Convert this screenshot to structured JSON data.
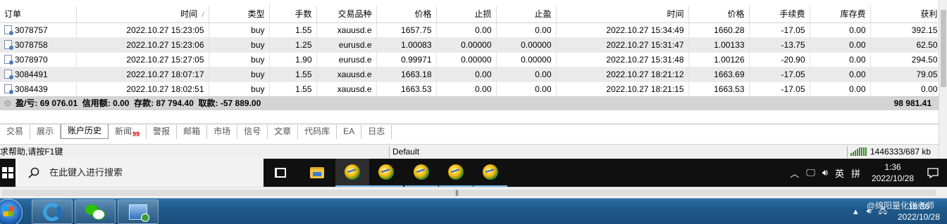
{
  "terminal": {
    "columns": [
      "订单",
      "时间",
      "类型",
      "手数",
      "交易品种",
      "价格",
      "止损",
      "止盈",
      "时间",
      "价格",
      "手续费",
      "库存费",
      "获利"
    ],
    "sort_indicator": "/",
    "orders": [
      {
        "ticket": "3078757",
        "open_time": "2022.10.27 15:23:05",
        "type": "buy",
        "lots": "1.55",
        "symbol": "xauusd.e",
        "open_price": "1657.75",
        "sl": "0.00",
        "tp": "0.00",
        "close_time": "2022.10.27 15:34:49",
        "close_price": "1660.28",
        "commission": "-17.05",
        "swap": "0.00",
        "profit": "392.15"
      },
      {
        "ticket": "3078758",
        "open_time": "2022.10.27 15:23:06",
        "type": "buy",
        "lots": "1.25",
        "symbol": "eurusd.e",
        "open_price": "1.00083",
        "sl": "0.00000",
        "tp": "0.00000",
        "close_time": "2022.10.27 15:31:47",
        "close_price": "1.00133",
        "commission": "-13.75",
        "swap": "0.00",
        "profit": "62.50"
      },
      {
        "ticket": "3078970",
        "open_time": "2022.10.27 15:27:05",
        "type": "buy",
        "lots": "1.90",
        "symbol": "eurusd.e",
        "open_price": "0.99971",
        "sl": "0.00000",
        "tp": "0.00000",
        "close_time": "2022.10.27 15:31:48",
        "close_price": "1.00126",
        "commission": "-20.90",
        "swap": "0.00",
        "profit": "294.50"
      },
      {
        "ticket": "3084491",
        "open_time": "2022.10.27 18:07:17",
        "type": "buy",
        "lots": "1.55",
        "symbol": "xauusd.e",
        "open_price": "1663.18",
        "sl": "0.00",
        "tp": "0.00",
        "close_time": "2022.10.27 18:21:12",
        "close_price": "1663.69",
        "commission": "-17.05",
        "swap": "0.00",
        "profit": "79.05"
      },
      {
        "ticket": "3084439",
        "open_time": "2022.10.27 18:02:51",
        "type": "buy",
        "lots": "1.55",
        "symbol": "xauusd.e",
        "open_price": "1663.53",
        "sl": "0.00",
        "tp": "0.00",
        "close_time": "2022.10.27 18:21:15",
        "close_price": "1663.53",
        "commission": "-17.05",
        "swap": "0.00",
        "profit": "0.00"
      }
    ],
    "summary": {
      "pl": "盈/亏: 69 076.01",
      "credit": "信用额: 0.00",
      "deposit": "存款: 87 794.40",
      "withdrawal": "取款: -57 889.00",
      "total": "98 981.41"
    },
    "tabs": [
      {
        "label": "交易"
      },
      {
        "label": "展示"
      },
      {
        "label": "账户历史",
        "active": true
      },
      {
        "label": "新闻",
        "badge": "99"
      },
      {
        "label": "警报"
      },
      {
        "label": "邮箱"
      },
      {
        "label": "市场"
      },
      {
        "label": "信号"
      },
      {
        "label": "文章"
      },
      {
        "label": "代码库"
      },
      {
        "label": "EA"
      },
      {
        "label": "日志"
      }
    ],
    "status": {
      "help": "求帮助,请按F1键",
      "profile": "Default",
      "traffic": "1446333/687 kb"
    }
  },
  "taskbar10": {
    "search_placeholder": "在此键入进行搜索",
    "ime": "英",
    "time": "1:36",
    "date": "2022/10/28"
  },
  "taskbar7": {
    "watermark": "@绵阳量化张老师",
    "time": "18:36",
    "date": "2022/10/28"
  },
  "colors": {
    "taskbar10_bg": "#101010",
    "taskbar7_bg": "#1f5a8b",
    "summary_bg": "#d4d4d4",
    "news_badge": "#d30000"
  }
}
